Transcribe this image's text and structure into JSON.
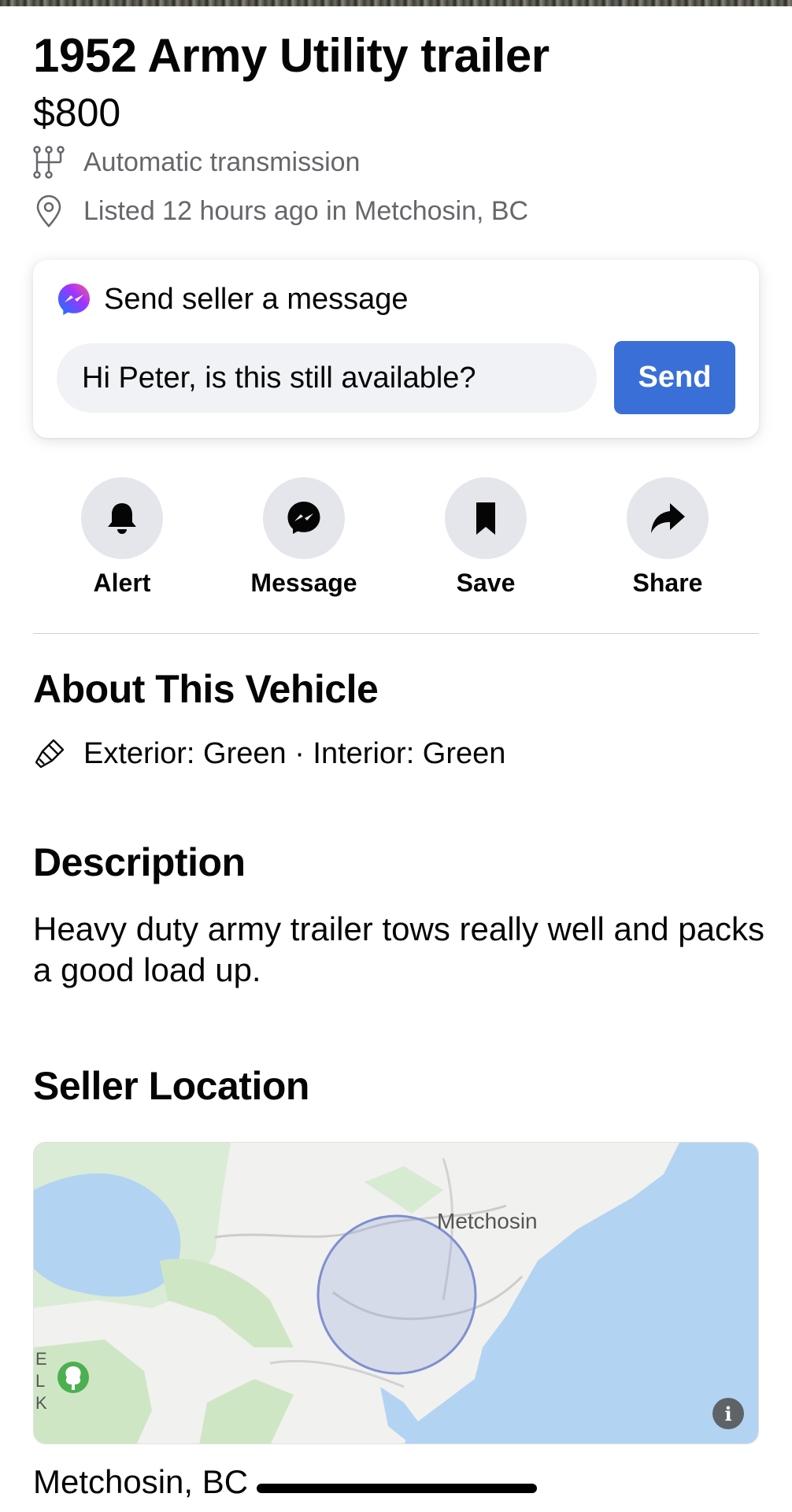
{
  "listing": {
    "title": "1952 Army Utility trailer",
    "price": "$800",
    "transmission": "Automatic transmission",
    "listed": "Listed 12 hours ago in Metchosin, BC"
  },
  "message_card": {
    "heading": "Send seller a message",
    "input_value": "Hi Peter, is this still available?",
    "send_label": "Send"
  },
  "actions": [
    {
      "label": "Alert",
      "icon": "bell-icon"
    },
    {
      "label": "Message",
      "icon": "messenger-icon"
    },
    {
      "label": "Save",
      "icon": "bookmark-icon"
    },
    {
      "label": "Share",
      "icon": "share-icon"
    }
  ],
  "about": {
    "heading": "About This Vehicle",
    "colors": "Exterior: Green · Interior: Green"
  },
  "description": {
    "heading": "Description",
    "text": "Heavy duty army trailer tows really well and packs a good load up."
  },
  "seller_location": {
    "heading": "Seller Location",
    "map_label": "Metchosin",
    "map_edge_letters": [
      "E",
      "L",
      "K"
    ],
    "info_label": "i",
    "location_name": "Metchosin, BC"
  },
  "colors": {
    "send_button": "#3a6fd8",
    "water": "#b3d3f2",
    "park": "#cfe6c5",
    "radius_circle": "#8ba0d8"
  }
}
